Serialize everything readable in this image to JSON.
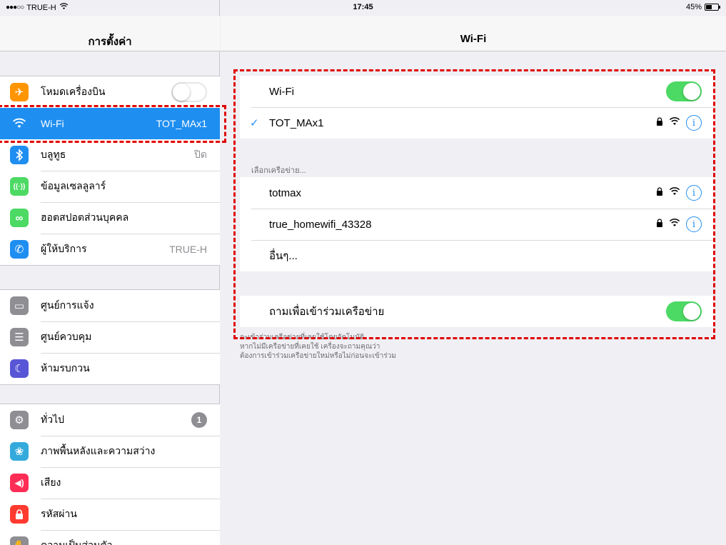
{
  "status_bar": {
    "carrier": "TRUE-H",
    "time": "17:45",
    "battery": "45%"
  },
  "sidebar": {
    "title": "การตั้งค่า",
    "group1": [
      {
        "label": "โหมดเครื่องบิน",
        "icon": "airplane-icon",
        "color": "#ff9500",
        "glyph": "✈"
      },
      {
        "label": "Wi-Fi",
        "value": "TOT_MAx1",
        "icon": "wifi-icon",
        "color": "#1f8ef1",
        "glyph": "ᯤ"
      },
      {
        "label": "บลูทูธ",
        "value": "ปิด",
        "icon": "bluetooth-icon",
        "color": "#1f8ef1",
        "glyph": "ᛒ"
      },
      {
        "label": "ข้อมูลเซลลูลาร์",
        "icon": "cellular-icon",
        "color": "#4cd964",
        "glyph": "((·))"
      },
      {
        "label": "ฮอตสปอตส่วนบุคคล",
        "icon": "hotspot-icon",
        "color": "#4cd964",
        "glyph": "∞"
      },
      {
        "label": "ผู้ให้บริการ",
        "value": "TRUE-H",
        "icon": "phone-icon",
        "color": "#1f8ef1",
        "glyph": "✆"
      }
    ],
    "group2": [
      {
        "label": "ศูนย์การแจ้ง",
        "icon": "notification-center-icon",
        "color": "#8e8e93",
        "glyph": "▭"
      },
      {
        "label": "ศูนย์ควบคุม",
        "icon": "control-center-icon",
        "color": "#8e8e93",
        "glyph": "☰"
      },
      {
        "label": "ห้ามรบกวน",
        "icon": "moon-icon",
        "color": "#5856d6",
        "glyph": "☾"
      }
    ],
    "group3": [
      {
        "label": "ทั่วไป",
        "badge": "1",
        "icon": "gear-icon",
        "color": "#8e8e93",
        "glyph": "⚙"
      },
      {
        "label": "ภาพพื้นหลังและความสว่าง",
        "icon": "wallpaper-icon",
        "color": "#34aadc",
        "glyph": "❀"
      },
      {
        "label": "เสียง",
        "icon": "sound-icon",
        "color": "#ff2d55",
        "glyph": "🔊"
      },
      {
        "label": "รหัสผ่าน",
        "icon": "passcode-lock-icon",
        "color": "#ff3b30",
        "glyph": "🔒"
      },
      {
        "label": "ความเป็นส่วนตัว",
        "icon": "privacy-hand-icon",
        "color": "#8e8e93",
        "glyph": "✋"
      }
    ]
  },
  "main": {
    "title": "Wi-Fi",
    "wifi_label": "Wi-Fi",
    "connected_network": "TOT_MAx1",
    "choose_network_caption": "เลือกเครือข่าย...",
    "networks": [
      "totmax",
      "true_homewifi_43328"
    ],
    "other_label": "อื่นๆ...",
    "ask_to_join_label": "ถามเพื่อเข้าร่วมเครือข่าย",
    "footer_note": [
      "จะเข้าร่วมเครือข่ายที่เคยใช้โดยอัตโนมัติ",
      "หากไม่มีเครือข่ายที่เคยใช้ เครื่องจะถามคุณว่า",
      "ต้องการเข้าร่วมเครือข่ายใหม่หรือไม่ก่อนจะเข้าร่วม"
    ]
  },
  "colors": {
    "accent": "#1f8ef1",
    "toggle_on": "#4cd964",
    "annotation": "#e00000"
  }
}
